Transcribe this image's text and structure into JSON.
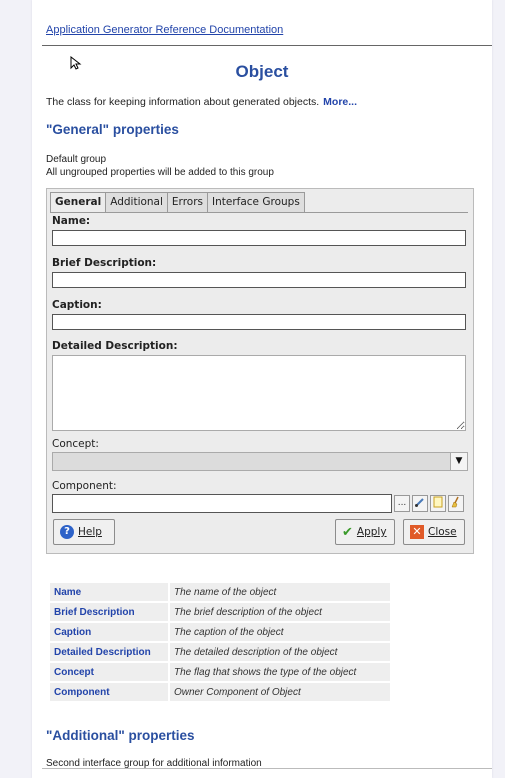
{
  "breadcrumb": "Application Generator Reference Documentation",
  "title": "Object",
  "intro": {
    "text": "The class for keeping information about generated objects.",
    "more_link": "More..."
  },
  "general_section": {
    "heading": "\"General\" properties",
    "group_name": "Default group",
    "group_note": "All ungrouped properties will be added to this group"
  },
  "dialog": {
    "tabs": [
      "General",
      "Additional",
      "Errors",
      "Interface Groups"
    ],
    "active_tab": "General",
    "fields": {
      "name_label": "Name:",
      "name_value": "",
      "brief_label": "Brief Description:",
      "brief_value": "",
      "caption_label": "Caption:",
      "caption_value": "",
      "detailed_label": "Detailed Description:",
      "detailed_value": "",
      "concept_label": "Concept:",
      "concept_value": "",
      "component_label": "Component:",
      "component_value": "",
      "component_browse": "..."
    },
    "buttons": {
      "help": "Help",
      "apply": "Apply",
      "close": "Close"
    }
  },
  "properties": [
    {
      "name": "Name",
      "description": "The name of the object"
    },
    {
      "name": "Brief Description",
      "description": "The brief description of the object"
    },
    {
      "name": "Caption",
      "description": "The caption of the object"
    },
    {
      "name": "Detailed Description",
      "description": "The detailed description of the object"
    },
    {
      "name": "Concept",
      "description": "The flag that shows the type of the object"
    },
    {
      "name": "Component",
      "description": "Owner Component of Object"
    }
  ],
  "additional_section": {
    "heading": "\"Additional\" properties",
    "text": "Second interface group for additional information"
  },
  "colors": {
    "heading": "#2a4fa0",
    "link": "#2244aa"
  },
  "icons": [
    "mouse-cursor-icon",
    "dropdown-arrow-icon",
    "brush-icon",
    "note-icon",
    "broom-icon",
    "help-icon",
    "checkmark-icon",
    "close-x-icon"
  ]
}
